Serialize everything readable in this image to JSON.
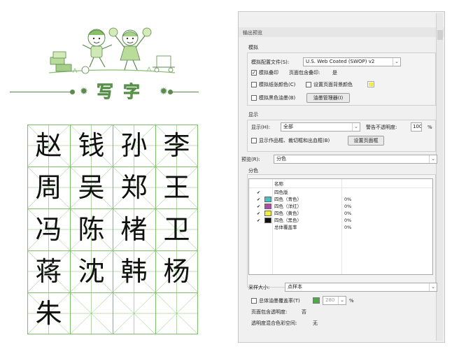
{
  "worksheet": {
    "title": "写字",
    "characters": [
      "赵",
      "钱",
      "孙",
      "李",
      "周",
      "吴",
      "郑",
      "王",
      "冯",
      "陈",
      "楮",
      "卫",
      "蒋",
      "沈",
      "韩",
      "杨",
      "朱"
    ],
    "grid_color": "#7fbf6a"
  },
  "dialog": {
    "title": "输出预览",
    "simulate": {
      "heading": "模拟",
      "profile_label": "模拟配置文件(S):",
      "profile_value": "U.S. Web Coated (SWOP) v2",
      "overprint_label": "模拟叠印",
      "overprint_checked": true,
      "page_overprint_label": "页面包含叠印:",
      "page_overprint_value": "是",
      "paper_color_label": "模拟纸张颜色(C)",
      "bg_color_label": "设置页面背景颜色",
      "black_ink_label": "模拟黑色油墨(B)",
      "ink_manager_label": "油墨管理器(I)"
    },
    "display": {
      "heading": "显示",
      "show_label": "显示(H):",
      "show_value": "全部",
      "warn_label": "警告不透明度:",
      "warn_value": "100",
      "warn_unit": "%",
      "art_trim_label": "显示作品框、裁切框和出血框(B)",
      "page_box_label": "设置页面框"
    },
    "preview": {
      "label": "预览(R):",
      "value": "分色"
    },
    "separations": {
      "heading": "分色",
      "column_name": "名称",
      "rows": [
        {
          "name": "四色版",
          "value": "",
          "color": "",
          "checked": true
        },
        {
          "name": "四色（青色）",
          "value": "0%",
          "color": "#49c0c8",
          "checked": true
        },
        {
          "name": "四色（洋红）",
          "value": "0%",
          "color": "#b14aa1",
          "checked": true
        },
        {
          "name": "四色（黄色）",
          "value": "0%",
          "color": "#f3ee3a",
          "checked": true
        },
        {
          "name": "四色（黑色）",
          "value": "0%",
          "color": "#111111",
          "checked": true
        },
        {
          "name": "总体覆盖率",
          "value": "0%",
          "color": "",
          "checked": false
        }
      ]
    },
    "sample": {
      "label": "采样大小:",
      "value": "点样本"
    },
    "total_ink": {
      "label": "总体油墨覆盖率(T)",
      "value": "280",
      "unit": "%",
      "swatch_color": "#4fa84a"
    },
    "page_transparency_label": "页面包含透明度:",
    "page_transparency_value": "否",
    "blend_space_label": "透明度混合色彩空间:",
    "blend_space_value": "无"
  }
}
